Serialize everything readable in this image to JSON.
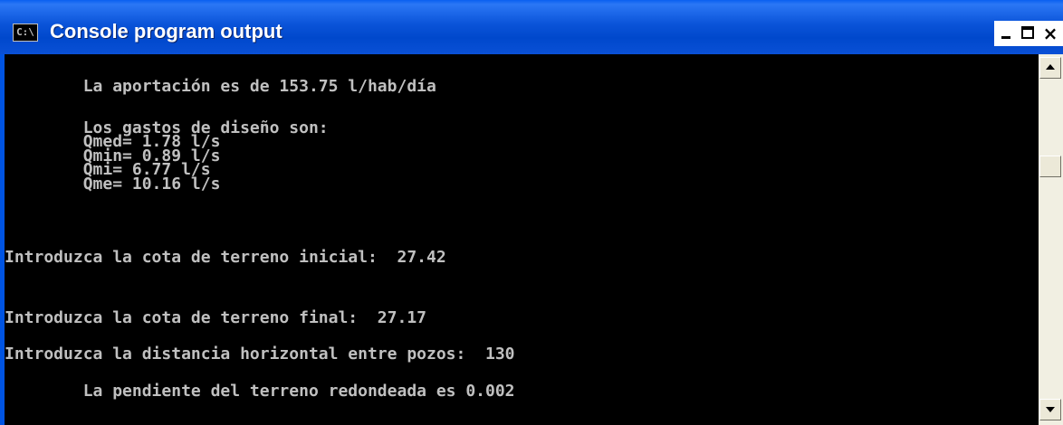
{
  "window": {
    "title": "Console program output",
    "icon_label": "C:\\",
    "icon": "console-icon"
  },
  "controls": {
    "minimize": "minimize-icon",
    "maximize": "maximize-icon",
    "close_label": "×"
  },
  "console": {
    "lines": [
      "        La aportación es de 153.75 l/hab/día",
      "        Los gastos de diseño son:",
      "        Qmed= 1.78 l/s",
      "        Qmin= 0.89 l/s",
      "        Qmi= 6.77 l/s",
      "        Qme= 10.16 l/s",
      "Introduzca la cota de terreno inicial:  27.42",
      "Introduzca la cota de terreno final:  27.17",
      "Introduzca la distancia horizontal entre pozos:  130",
      "        La pendiente del terreno redondeada es 0.002"
    ]
  },
  "colors": {
    "console_bg": "#000000",
    "console_text": "#c0c0c0",
    "titlebar": "#0054e3"
  }
}
